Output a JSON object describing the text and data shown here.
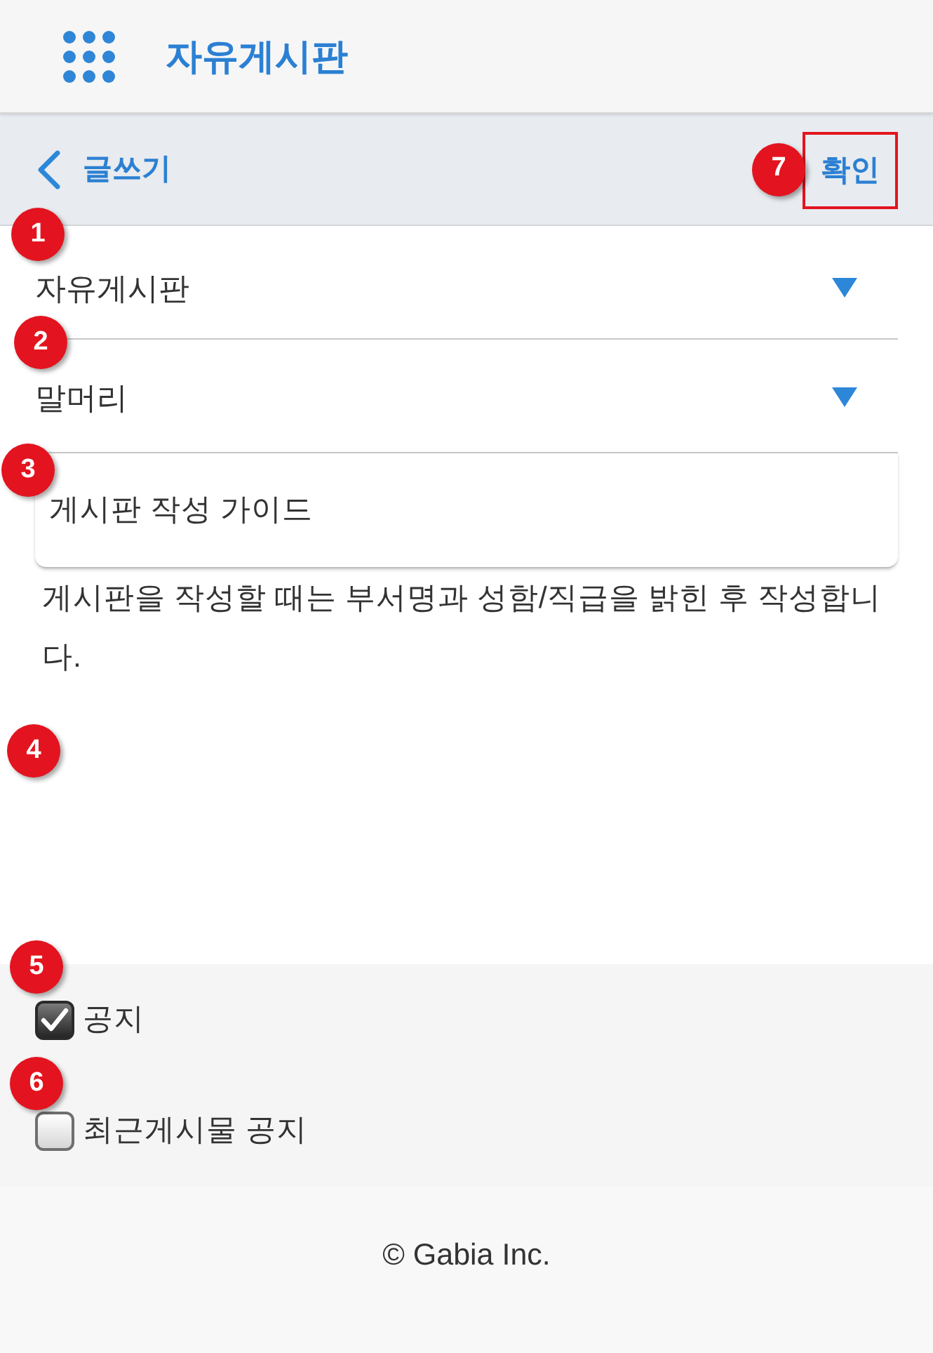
{
  "header": {
    "title": "자유게시판"
  },
  "toolbar": {
    "title": "글쓰기",
    "confirm_button": {
      "label": "확인",
      "highlighted": true,
      "callout": "7"
    }
  },
  "form": {
    "board_select": {
      "value": "자유게시판",
      "callout": "1"
    },
    "prefix_select": {
      "value": "말머리",
      "callout": "2"
    },
    "title_field": {
      "value": "게시판 작성 가이드",
      "callout": "3"
    },
    "guide_text": "게시판을 작성할 때는 부서명과 성함/직급을 밝힌 후 작성합니다.",
    "content_field": {
      "callout": "4"
    }
  },
  "options": [
    {
      "label": "공지",
      "checked": true,
      "callout": "5"
    },
    {
      "label": "최근게시물 공지",
      "checked": false,
      "callout": "6"
    }
  ],
  "footer": {
    "copyright": "© Gabia Inc."
  }
}
